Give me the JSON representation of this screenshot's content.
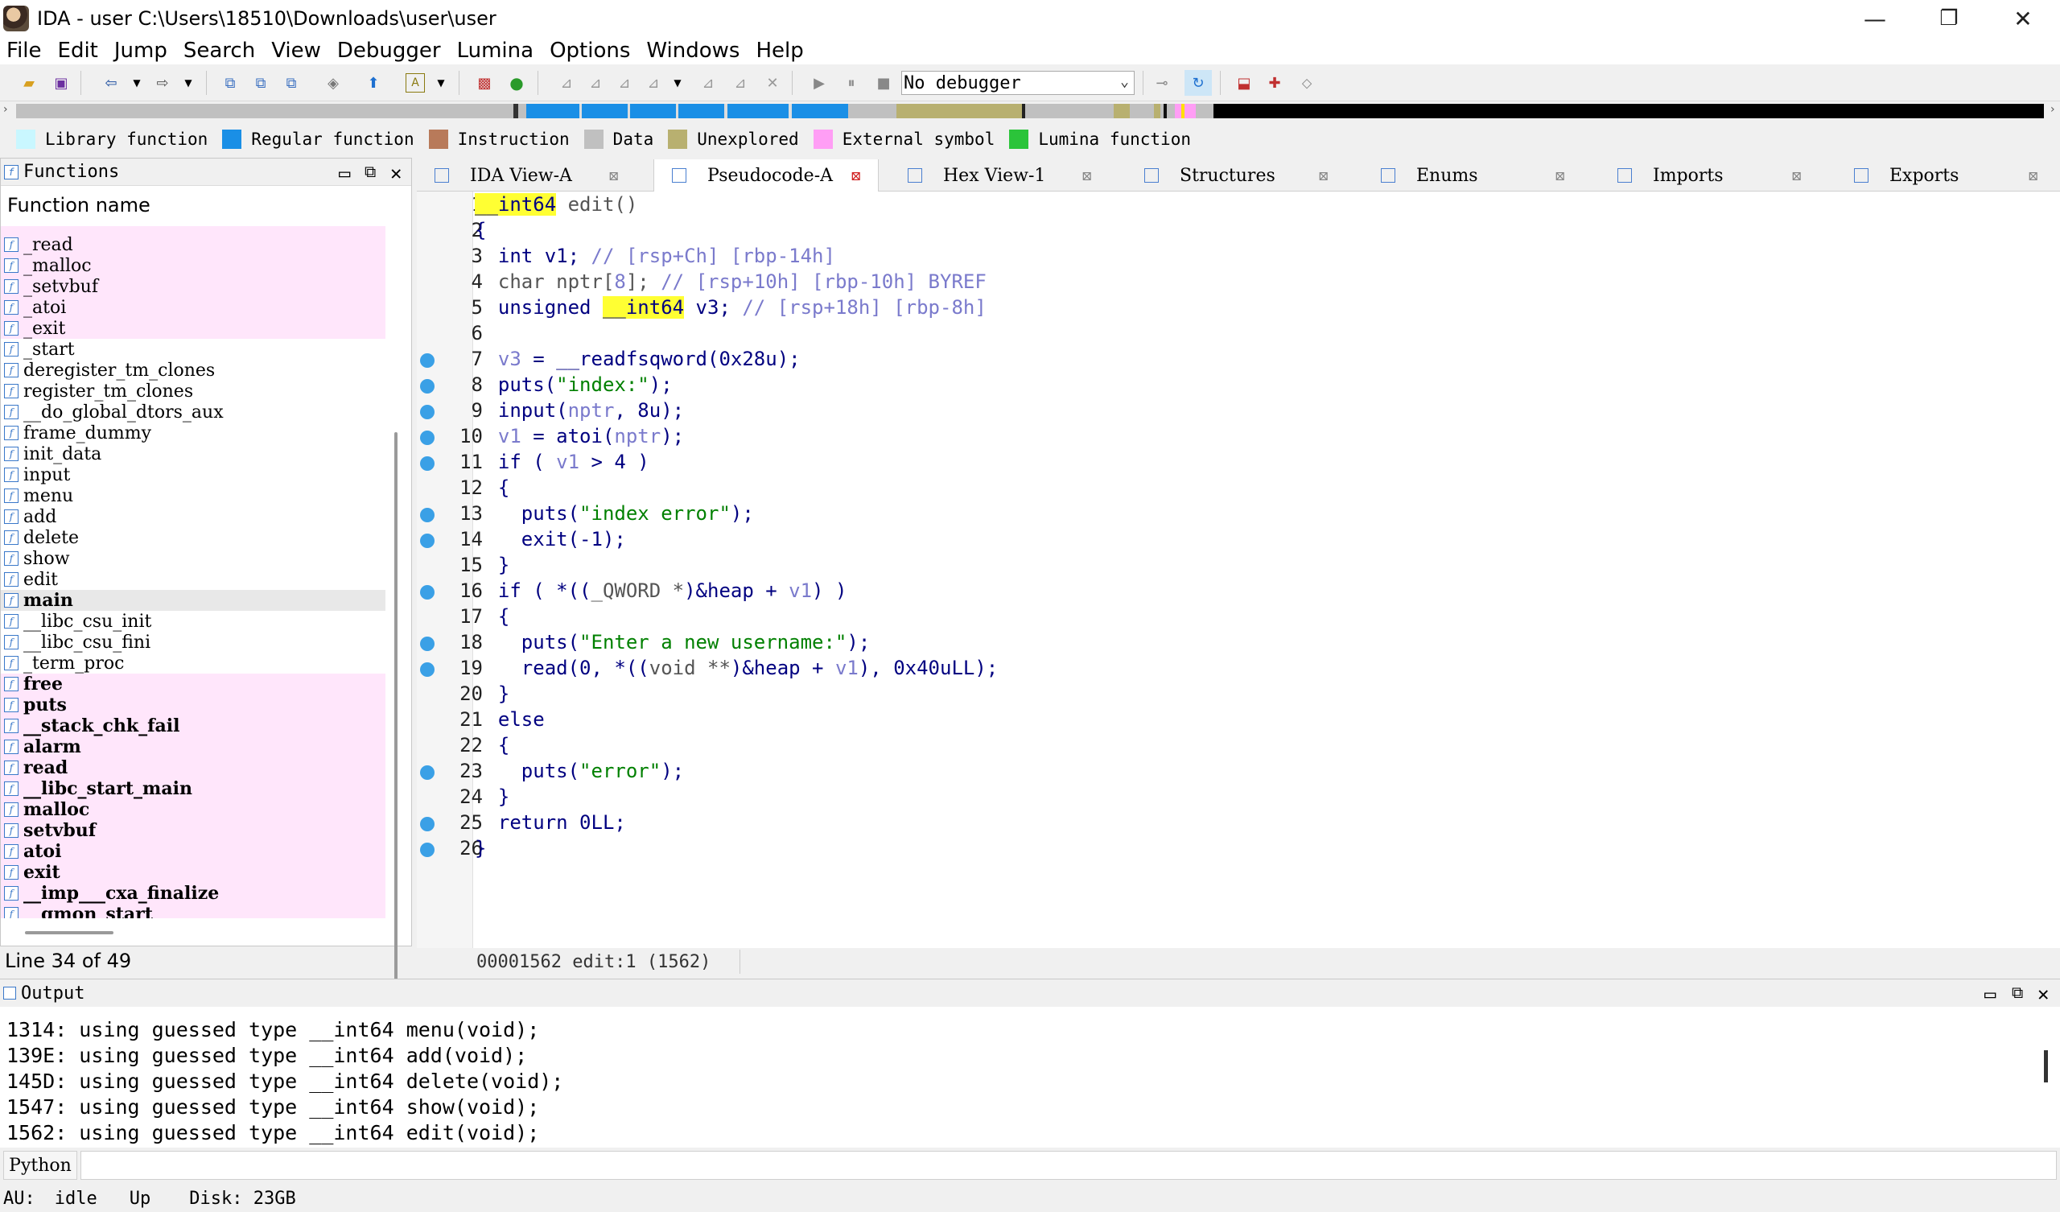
{
  "window": {
    "title": "IDA - user C:\\Users\\18510\\Downloads\\user\\user",
    "minimize": "—",
    "maximize": "❐",
    "close": "✕"
  },
  "menu": [
    "File",
    "Edit",
    "Jump",
    "Search",
    "View",
    "Debugger",
    "Lumina",
    "Options",
    "Windows",
    "Help"
  ],
  "toolbar": {
    "debugger_value": "No debugger"
  },
  "legend": [
    {
      "label": "Library function",
      "color": "#c9f7ff"
    },
    {
      "label": "Regular function",
      "color": "#1a8fe6"
    },
    {
      "label": "Instruction",
      "color": "#b87a5a"
    },
    {
      "label": "Data",
      "color": "#c0c0c0"
    },
    {
      "label": "Unexplored",
      "color": "#b8b070"
    },
    {
      "label": "External symbol",
      "color": "#ff9ef5"
    },
    {
      "label": "Lumina function",
      "color": "#2bc43a"
    }
  ],
  "functions_panel": {
    "title": "Functions",
    "column": "Function name",
    "status": "Line 34 of 49",
    "items": [
      {
        "name": "_read",
        "style": "pink"
      },
      {
        "name": "_malloc",
        "style": "pink"
      },
      {
        "name": "_setvbuf",
        "style": "pink"
      },
      {
        "name": "_atoi",
        "style": "pink"
      },
      {
        "name": "_exit",
        "style": "pink"
      },
      {
        "name": "_start",
        "style": ""
      },
      {
        "name": "deregister_tm_clones",
        "style": ""
      },
      {
        "name": "register_tm_clones",
        "style": ""
      },
      {
        "name": "__do_global_dtors_aux",
        "style": ""
      },
      {
        "name": "frame_dummy",
        "style": ""
      },
      {
        "name": "init_data",
        "style": ""
      },
      {
        "name": "input",
        "style": ""
      },
      {
        "name": "menu",
        "style": ""
      },
      {
        "name": "add",
        "style": ""
      },
      {
        "name": "delete",
        "style": ""
      },
      {
        "name": "show",
        "style": ""
      },
      {
        "name": "edit",
        "style": ""
      },
      {
        "name": "main",
        "style": "selected"
      },
      {
        "name": "__libc_csu_init",
        "style": ""
      },
      {
        "name": "__libc_csu_fini",
        "style": ""
      },
      {
        "name": "_term_proc",
        "style": ""
      },
      {
        "name": "free",
        "style": "pink"
      },
      {
        "name": "puts",
        "style": "pink"
      },
      {
        "name": "__stack_chk_fail",
        "style": "pink"
      },
      {
        "name": "alarm",
        "style": "pink"
      },
      {
        "name": "read",
        "style": "pink"
      },
      {
        "name": "__libc_start_main",
        "style": "pink"
      },
      {
        "name": "malloc",
        "style": "pink"
      },
      {
        "name": "setvbuf",
        "style": "pink"
      },
      {
        "name": "atoi",
        "style": "pink"
      },
      {
        "name": "exit",
        "style": "pink"
      },
      {
        "name": "__imp___cxa_finalize",
        "style": "pink"
      },
      {
        "name": "__gmon_start__",
        "style": "pink"
      }
    ]
  },
  "tabs": [
    {
      "label": "IDA View-A",
      "active": false
    },
    {
      "label": "Pseudocode-A",
      "active": true
    },
    {
      "label": "Hex View-1",
      "active": false
    },
    {
      "label": "Structures",
      "active": false
    },
    {
      "label": "Enums",
      "active": false
    },
    {
      "label": "Imports",
      "active": false
    },
    {
      "label": "Exports",
      "active": false
    }
  ],
  "code": {
    "status": "00001562 edit:1 (1562)",
    "lines": [
      {
        "n": "1",
        "bp": false,
        "html": "<span class='c-hl'>__int64</span><span style='color:#555'> edit()</span>"
      },
      {
        "n": "2",
        "bp": false,
        "html": "{"
      },
      {
        "n": "3",
        "bp": false,
        "html": "  int v1; <span class='c-cmt'>// [rsp+Ch] [rbp-14h]</span>"
      },
      {
        "n": "4",
        "bp": false,
        "html": "  <span style='color:#555'>char nptr[</span><span class='c-var'>8</span><span style='color:#555'>];</span> <span class='c-cmt'>// [rsp+10h] [rbp-10h] BYREF</span>"
      },
      {
        "n": "5",
        "bp": false,
        "html": "  unsigned <span class='c-hl'>__int64</span> v3; <span class='c-cmt'>// [rsp+18h] [rbp-8h]</span>"
      },
      {
        "n": "6",
        "bp": false,
        "html": ""
      },
      {
        "n": "7",
        "bp": true,
        "html": "  <span class='c-var'>v3</span> = __readfsqword(0x28u);"
      },
      {
        "n": "8",
        "bp": true,
        "html": "  puts(<span class='c-str'>\"index:\"</span>);"
      },
      {
        "n": "9",
        "bp": true,
        "html": "  input(<span class='c-var'>nptr</span>, 8u);"
      },
      {
        "n": "10",
        "bp": true,
        "html": "  <span class='c-var'>v1</span> = atoi(<span class='c-var'>nptr</span>);"
      },
      {
        "n": "11",
        "bp": true,
        "html": "  if ( <span class='c-var'>v1</span> &gt; 4 )"
      },
      {
        "n": "12",
        "bp": false,
        "html": "  {"
      },
      {
        "n": "13",
        "bp": true,
        "html": "    puts(<span class='c-str'>\"index error\"</span>);"
      },
      {
        "n": "14",
        "bp": true,
        "html": "    exit(-1);"
      },
      {
        "n": "15",
        "bp": false,
        "html": "  }"
      },
      {
        "n": "16",
        "bp": true,
        "html": "  if ( *((<span style='color:#555'>_QWORD *</span>)&amp;heap + <span class='c-var'>v1</span>) )"
      },
      {
        "n": "17",
        "bp": false,
        "html": "  {"
      },
      {
        "n": "18",
        "bp": true,
        "html": "    puts(<span class='c-str'>\"Enter a new username:\"</span>);"
      },
      {
        "n": "19",
        "bp": true,
        "html": "    read(0, *((<span style='color:#555'>void **</span>)&amp;heap + <span class='c-var'>v1</span>), 0x40uLL);"
      },
      {
        "n": "20",
        "bp": false,
        "html": "  }"
      },
      {
        "n": "21",
        "bp": false,
        "html": "  else"
      },
      {
        "n": "22",
        "bp": false,
        "html": "  {"
      },
      {
        "n": "23",
        "bp": true,
        "html": "    puts(<span class='c-str'>\"error\"</span>);"
      },
      {
        "n": "24",
        "bp": false,
        "html": "  }"
      },
      {
        "n": "25",
        "bp": true,
        "html": "  return 0LL;"
      },
      {
        "n": "26",
        "bp": true,
        "html": "}"
      }
    ]
  },
  "output": {
    "title": "Output",
    "lines": [
      "1314: using guessed type __int64 menu(void);",
      "139E: using guessed type __int64 add(void);",
      "145D: using guessed type __int64 delete(void);",
      "1547: using guessed type __int64 show(void);",
      "1562: using guessed type __int64 edit(void);"
    ]
  },
  "python": {
    "label": "Python"
  },
  "status": {
    "au": "AU:",
    "state": "idle",
    "dir": "Up",
    "disk": "Disk: 23GB"
  }
}
